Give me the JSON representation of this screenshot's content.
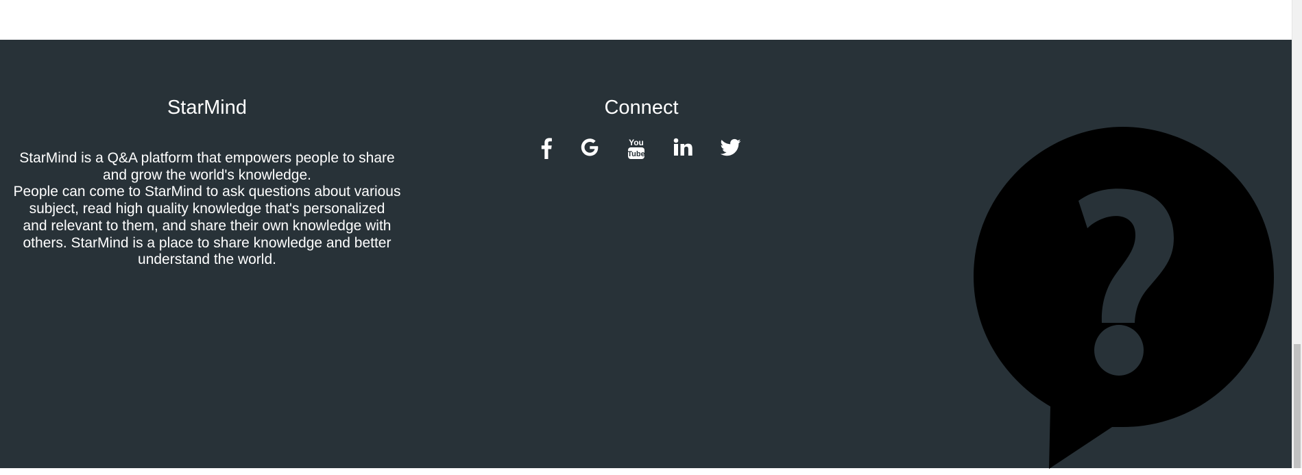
{
  "footer": {
    "about": {
      "title": "StarMind",
      "lines": [
        "StarMind is a Q&A platform that empowers people to share and grow the world's knowledge.",
        "People can come to StarMind to ask questions about various subject, read high quality knowledge that's personalized",
        "and relevant to them, and share their own knowledge with others. StarMind is a place to share knowledge and better understand the world."
      ]
    },
    "connect": {
      "title": "Connect",
      "links": [
        {
          "icon": "facebook-icon"
        },
        {
          "icon": "google-icon"
        },
        {
          "icon": "youtube-icon"
        },
        {
          "icon": "linkedin-icon"
        },
        {
          "icon": "twitter-icon"
        }
      ]
    },
    "mascot": {
      "icon": "question-bubble-icon",
      "bubble_color": "#000000",
      "mark_color": "#283238"
    }
  },
  "colors": {
    "footer_background": "#283238",
    "text": "#ffffff"
  }
}
